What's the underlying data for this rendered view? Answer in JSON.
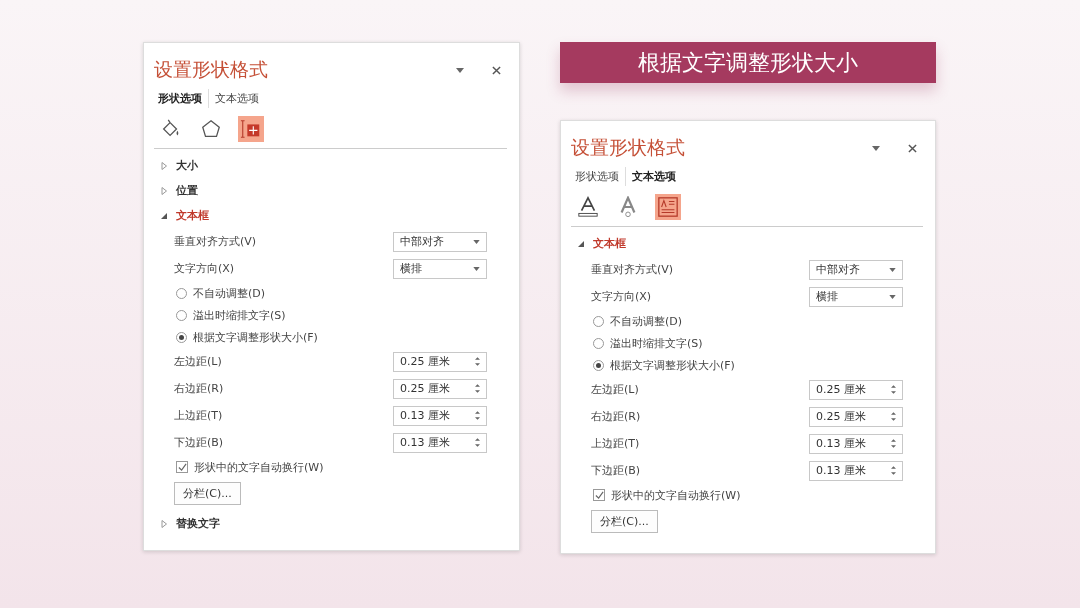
{
  "banner": {
    "text": "根据文字调整形状大小"
  },
  "panels": [
    {
      "title": "设置形状格式",
      "tabs": [
        {
          "label": "形状选项",
          "selected": true
        },
        {
          "label": "文本选项",
          "selected": false
        }
      ],
      "icons": [
        {
          "kind": "fill",
          "selected": false
        },
        {
          "kind": "line",
          "selected": false
        },
        {
          "kind": "size",
          "selected": true
        }
      ],
      "sections": [
        {
          "label": "大小",
          "expanded": false
        },
        {
          "label": "位置",
          "expanded": false
        },
        {
          "label": "文本框",
          "expanded": true,
          "dropdowns": [
            {
              "label": "垂直对齐方式(V)",
              "value": "中部对齐"
            },
            {
              "label": "文字方向(X)",
              "value": "横排"
            }
          ],
          "radios": [
            {
              "label": "不自动调整(D)",
              "selected": false
            },
            {
              "label": "溢出时缩排文字(S)",
              "selected": false
            },
            {
              "label": "根据文字调整形状大小(F)",
              "selected": true
            }
          ],
          "spinners": [
            {
              "label": "左边距(L)",
              "value": "0.25 厘米"
            },
            {
              "label": "右边距(R)",
              "value": "0.25 厘米"
            },
            {
              "label": "上边距(T)",
              "value": "0.13 厘米"
            },
            {
              "label": "下边距(B)",
              "value": "0.13 厘米"
            }
          ],
          "checkbox": {
            "label": "形状中的文字自动换行(W)",
            "checked": true
          },
          "button": "分栏(C)..."
        },
        {
          "label": "替换文字",
          "expanded": false
        }
      ]
    },
    {
      "title": "设置形状格式",
      "tabs": [
        {
          "label": "形状选项",
          "selected": false
        },
        {
          "label": "文本选项",
          "selected": true
        }
      ],
      "icons": [
        {
          "kind": "text-fill",
          "selected": false
        },
        {
          "kind": "text-outline",
          "selected": false
        },
        {
          "kind": "textbox",
          "selected": true
        }
      ],
      "sections": [
        {
          "label": "文本框",
          "expanded": true,
          "dropdowns": [
            {
              "label": "垂直对齐方式(V)",
              "value": "中部对齐"
            },
            {
              "label": "文字方向(X)",
              "value": "横排"
            }
          ],
          "radios": [
            {
              "label": "不自动调整(D)",
              "selected": false
            },
            {
              "label": "溢出时缩排文字(S)",
              "selected": false
            },
            {
              "label": "根据文字调整形状大小(F)",
              "selected": true
            }
          ],
          "spinners": [
            {
              "label": "左边距(L)",
              "value": "0.25 厘米"
            },
            {
              "label": "右边距(R)",
              "value": "0.25 厘米"
            },
            {
              "label": "上边距(T)",
              "value": "0.13 厘米"
            },
            {
              "label": "下边距(B)",
              "value": "0.13 厘米"
            }
          ],
          "checkbox": {
            "label": "形状中的文字自动换行(W)",
            "checked": true
          },
          "button": "分栏(C)..."
        }
      ]
    }
  ]
}
